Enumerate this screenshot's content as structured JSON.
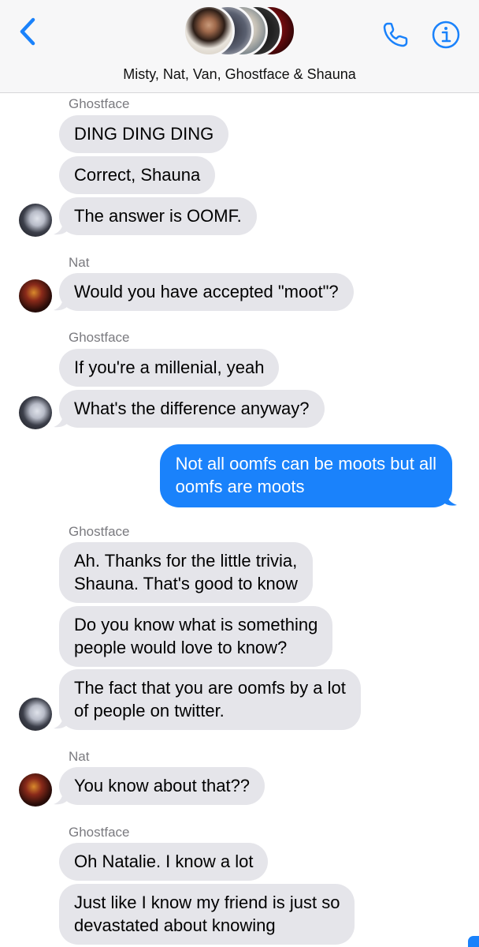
{
  "header": {
    "title": "Misty, Nat, Van, Ghostface & Shauna",
    "back_icon": "chevron-left-icon",
    "call_icon": "phone-icon",
    "info_icon": "info-icon",
    "accent": "#1a82fb"
  },
  "messages": [
    {
      "sender": "Ghostface",
      "bubbles": [
        "DING DING DING",
        "Correct, Shauna",
        "The answer is OOMF."
      ]
    },
    {
      "sender": "Nat",
      "bubbles": [
        "Would you have accepted \"moot\"?"
      ]
    },
    {
      "sender": "Ghostface",
      "bubbles": [
        "If you're a millenial, yeah",
        "What's the difference anyway?"
      ]
    },
    {
      "sender": "me",
      "bubbles": [
        "Not all oomfs can be moots but all\noomfs are moots"
      ]
    },
    {
      "sender": "Ghostface",
      "bubbles": [
        "Ah. Thanks for the little trivia,\nShauna. That's good to know",
        "Do you know what is something\npeople would love to know?",
        "The fact that you are oomfs by a lot\nof people on twitter."
      ]
    },
    {
      "sender": "Nat",
      "bubbles": [
        "You know about that??"
      ]
    },
    {
      "sender": "Ghostface",
      "bubbles": [
        "Oh Natalie. I know a lot",
        "Just like I know my friend is just so\ndevastated about knowing"
      ]
    }
  ],
  "colors": {
    "incoming_bubble": "#e5e5ea",
    "outgoing_bubble": "#1a82fb",
    "sender_name": "#7a7a7f"
  }
}
